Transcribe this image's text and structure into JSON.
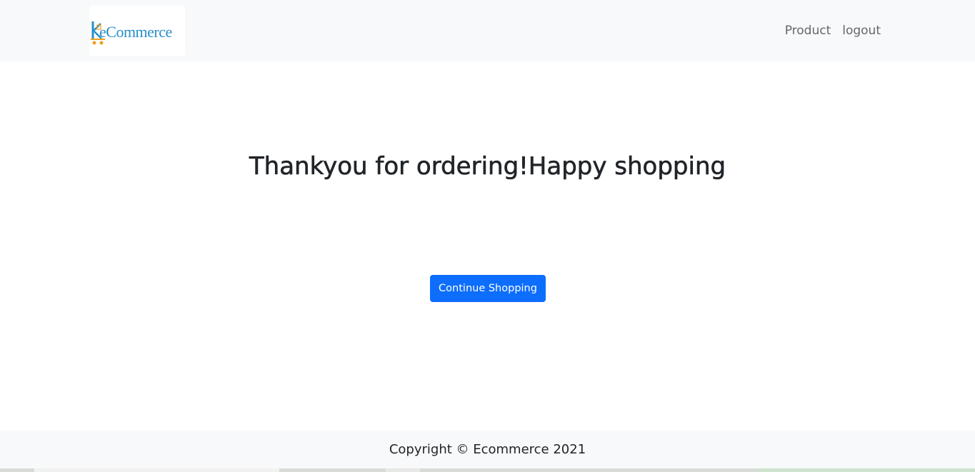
{
  "navbar": {
    "brand_text": "eCommerce",
    "links": [
      {
        "label": "Product"
      },
      {
        "label": "logout"
      }
    ]
  },
  "main": {
    "heading": "Thankyou for ordering!Happy shopping",
    "continue_button_label": "Continue Shopping"
  },
  "footer": {
    "copyright": "Copyright © Ecommerce 2021"
  },
  "colors": {
    "navbar_bg": "#f8f9fa",
    "primary": "#0d6efd",
    "brand_blue": "#2a8fc8",
    "brand_orange": "#f0a020",
    "text": "#212529"
  },
  "icons": {
    "brand_logo": "shopping-cart-k-logo-icon"
  }
}
